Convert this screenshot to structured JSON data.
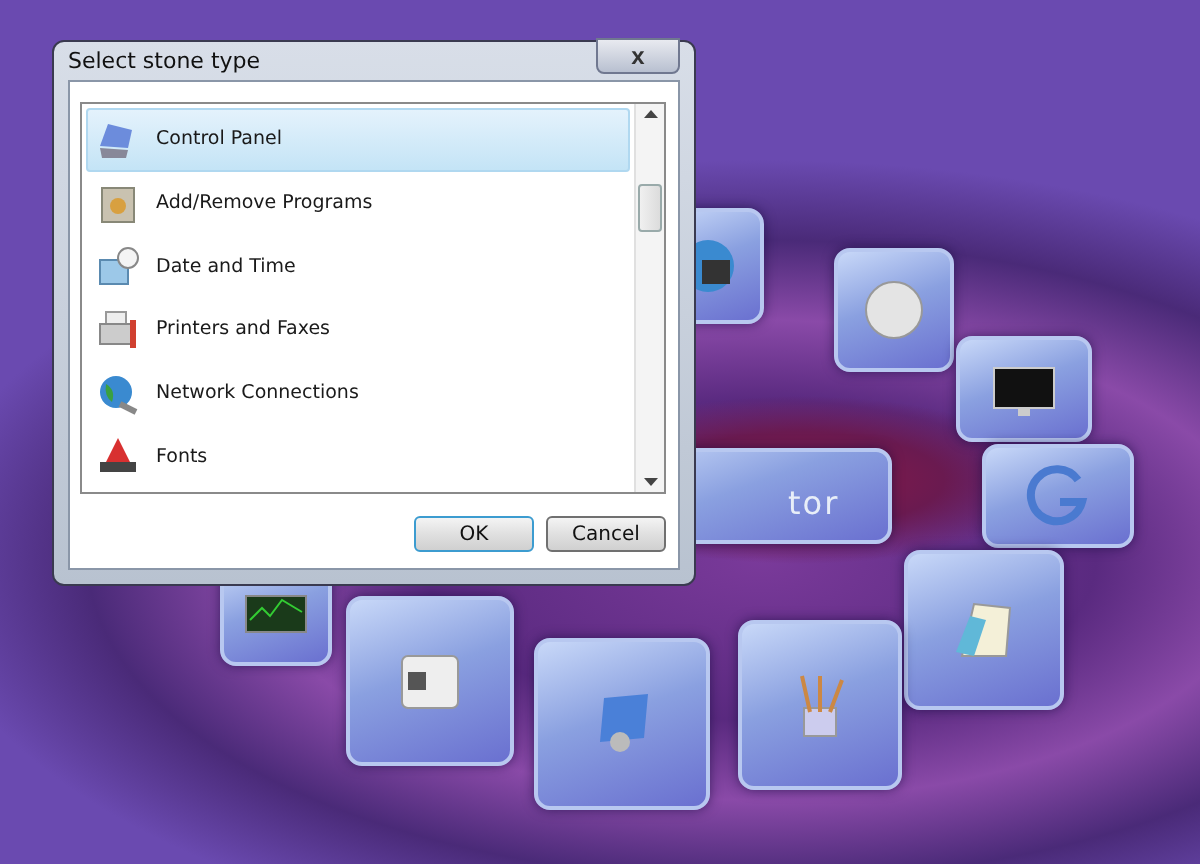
{
  "dialog": {
    "title": "Select stone type",
    "close": "x",
    "items": [
      {
        "label": "Control Panel",
        "selected": true
      },
      {
        "label": "Add/Remove Programs",
        "selected": false
      },
      {
        "label": "Date and Time",
        "selected": false
      },
      {
        "label": "Printers and Faxes",
        "selected": false
      },
      {
        "label": "Network Connections",
        "selected": false
      },
      {
        "label": "Fonts",
        "selected": false
      }
    ],
    "buttons": [
      {
        "label": "OK",
        "default": true
      },
      {
        "label": "Cancel",
        "default": false
      }
    ]
  },
  "desktop": {
    "tile_label": "tor"
  }
}
